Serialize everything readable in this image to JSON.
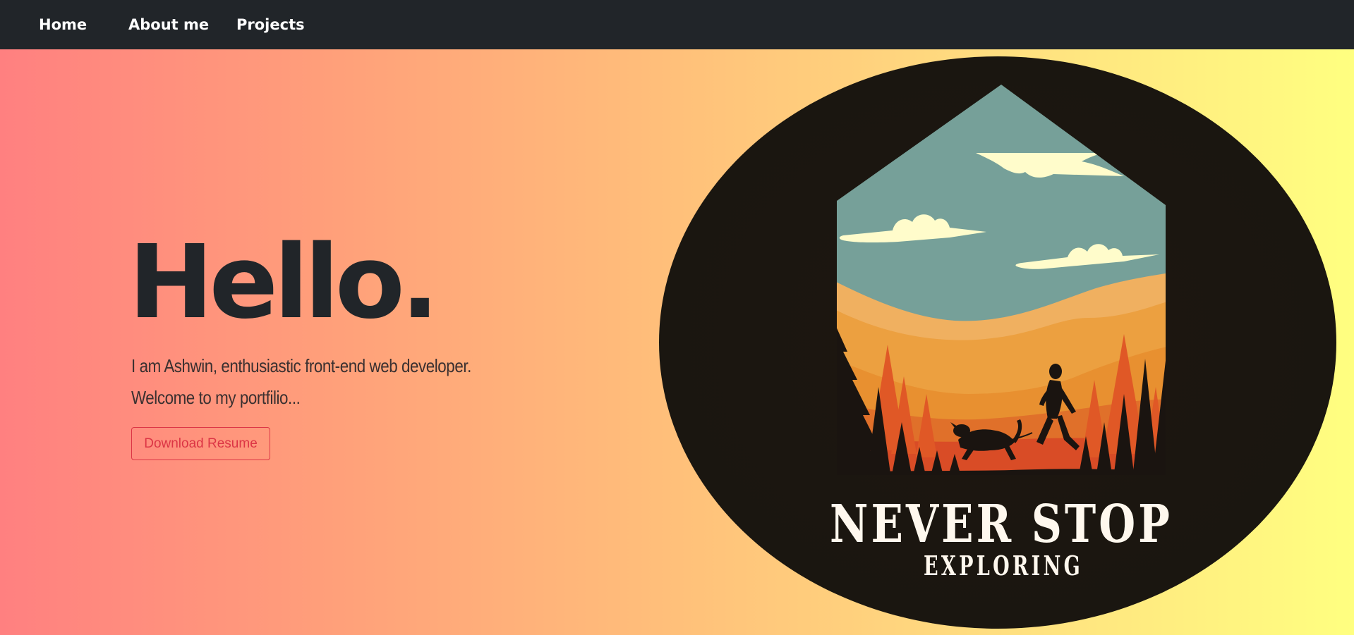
{
  "nav": {
    "items": [
      {
        "label": "Home"
      },
      {
        "label": "About me"
      },
      {
        "label": "Projects"
      }
    ]
  },
  "hero": {
    "title": "Hello.",
    "line1": "I am Ashwin, enthusiastic front-end web developer.",
    "line2": "Welcome to my portfilio...",
    "button_label": "Download Resume"
  },
  "badge": {
    "headline": "NEVER STOP",
    "subline": "EXPLORING"
  },
  "colors": {
    "navbar": "#212529",
    "title": "#212529",
    "button": "#dc3545",
    "badge_bg": "#1a1410",
    "sky": "#76a099",
    "cloud": "#fffccb"
  }
}
